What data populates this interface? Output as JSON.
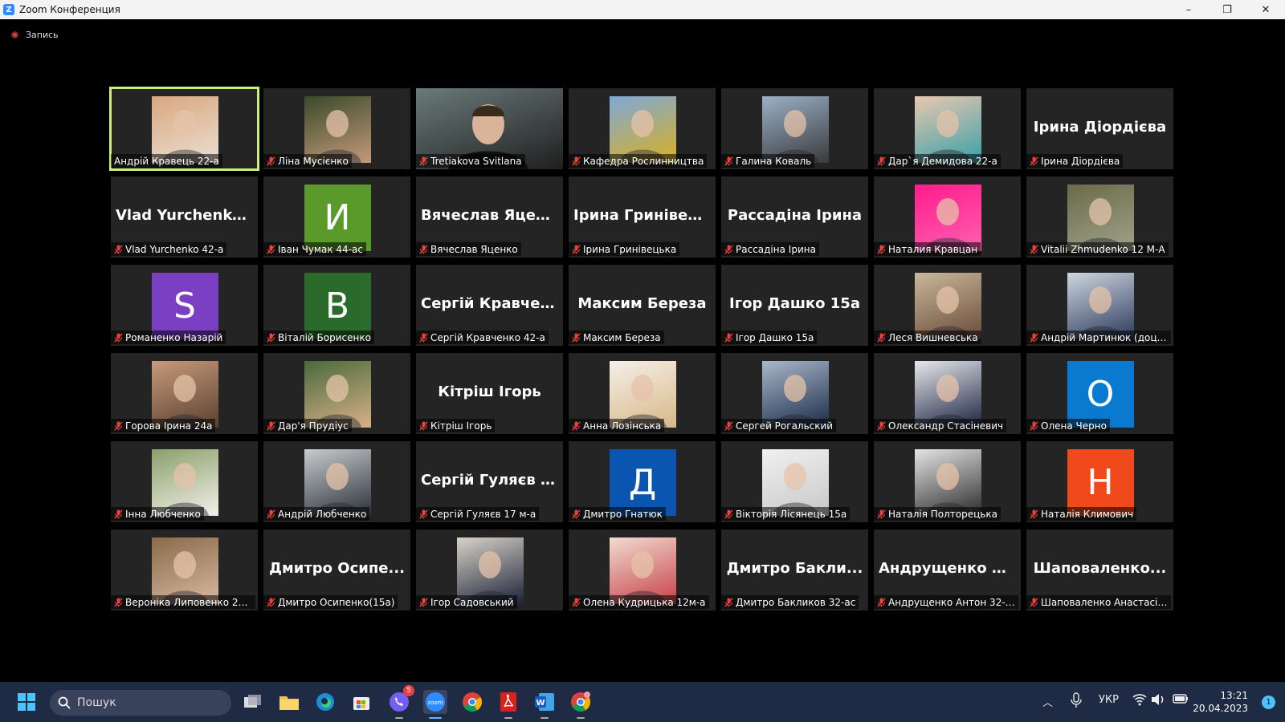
{
  "window": {
    "title": "Zoom Конференция",
    "minimize_glyph": "–",
    "restore_glyph": "❐",
    "close_glyph": "✕"
  },
  "recording": {
    "label": "Запись"
  },
  "participants": [
    {
      "label": "Андрій Кравець 22-а",
      "muted": false,
      "type": "photo",
      "active": true,
      "c1": "#d9a77f",
      "c2": "#eadfd2"
    },
    {
      "label": "Ліна Мусієнко",
      "muted": true,
      "type": "photo",
      "c1": "#3a4a2a",
      "c2": "#c49a7a"
    },
    {
      "label": "Tretiakova Svitlana",
      "muted": true,
      "type": "video",
      "c1": "#6b7a7a",
      "c2": "#1f1f1f"
    },
    {
      "label": "Кафедра Рослинництва",
      "muted": true,
      "type": "photo",
      "c1": "#7fa8d8",
      "c2": "#d9b021"
    },
    {
      "label": "Галина  Коваль",
      "muted": true,
      "type": "photo",
      "c1": "#9bb0c8",
      "c2": "#3a3a3a"
    },
    {
      "label": "Дар`я  Демидова 22-а",
      "muted": true,
      "type": "photo",
      "c1": "#e7c8b0",
      "c2": "#3aa0a8"
    },
    {
      "label": "Ірина Діордієва",
      "muted": true,
      "type": "name",
      "big": "Ірина Діордієва"
    },
    {
      "label": "Vlad Yurchenko 42-а",
      "muted": true,
      "type": "name",
      "big": "Vlad Yurchenko..."
    },
    {
      "label": "Іван Чумак 44-ас",
      "muted": true,
      "type": "avatar",
      "letter": "И",
      "color": "#5a9a2a"
    },
    {
      "label": "Вячеслав Яценко",
      "muted": true,
      "type": "name",
      "big": "Вячеслав Яценко"
    },
    {
      "label": "Ірина Гринівецька",
      "muted": true,
      "type": "name",
      "big": "Ірина Гринівец..."
    },
    {
      "label": "Рассадіна Ірина",
      "muted": true,
      "type": "name",
      "big": "Рассадіна Ірина"
    },
    {
      "label": "Наталия Кравцан",
      "muted": true,
      "type": "photo",
      "c1": "#ff1c8c",
      "c2": "#ff60b0"
    },
    {
      "label": "Vitalii Zhmudenko 12 М-А",
      "muted": true,
      "type": "photo",
      "c1": "#6b6a4a",
      "c2": "#a0a28a"
    },
    {
      "label": "Романенко Назарій",
      "muted": true,
      "type": "avatar",
      "letter": "S",
      "color": "#7a3fc2"
    },
    {
      "label": "Віталій Борисенко",
      "muted": true,
      "type": "avatar",
      "letter": "B",
      "color": "#2a6a2a"
    },
    {
      "label": "Сергій Кравченко 42-а",
      "muted": true,
      "type": "name",
      "big": "Сергій Кравчен..."
    },
    {
      "label": "Максим Береза",
      "muted": true,
      "type": "name",
      "big": "Максим Береза"
    },
    {
      "label": "Ігор Дашко 15а",
      "muted": true,
      "type": "name",
      "big": "Ігор Дашко 15а"
    },
    {
      "label": "Леся Вишневська",
      "muted": true,
      "type": "photo",
      "c1": "#c8b89a",
      "c2": "#6a4a3a"
    },
    {
      "label": "Андрій Мартинюк (доце...",
      "muted": true,
      "type": "photo",
      "c1": "#cfd6e0",
      "c2": "#2a3a5a"
    },
    {
      "label": "Горова Ірина 24а",
      "muted": true,
      "type": "photo",
      "c1": "#c89a7a",
      "c2": "#5a4030"
    },
    {
      "label": "Дар'я Прудіус",
      "muted": true,
      "type": "photo",
      "c1": "#4a6a3a",
      "c2": "#d8b08a"
    },
    {
      "label": "Кітріш Ігорь",
      "muted": true,
      "type": "name",
      "big": "Кітріш Ігорь"
    },
    {
      "label": "Анна Лозінська",
      "muted": true,
      "type": "photo",
      "c1": "#f4efe8",
      "c2": "#d8b888"
    },
    {
      "label": "Сергей Рогальский",
      "muted": true,
      "type": "photo",
      "c1": "#aab8c8",
      "c2": "#1a2a4a"
    },
    {
      "label": "Олександр Стасіневич",
      "muted": true,
      "type": "photo",
      "c1": "#e6e8ec",
      "c2": "#1a2240"
    },
    {
      "label": "Олена Черно",
      "muted": true,
      "type": "avatar",
      "letter": "О",
      "color": "#0a7ad0"
    },
    {
      "label": "Інна Любченко",
      "muted": true,
      "type": "photo",
      "c1": "#8aa06a",
      "c2": "#f2f0ea"
    },
    {
      "label": "Андрій Любченко",
      "muted": true,
      "type": "photo",
      "c1": "#c8ccd0",
      "c2": "#2a3038"
    },
    {
      "label": "Сергій Гуляєв 17 м-а",
      "muted": true,
      "type": "name",
      "big": "Сергій Гуляєв 1..."
    },
    {
      "label": "Дмитро Гнатюк",
      "muted": true,
      "type": "avatar",
      "letter": "Д",
      "color": "#0a55b0"
    },
    {
      "label": "Вікторія Лісянець 15а",
      "muted": true,
      "type": "photo",
      "c1": "#f0f0f0",
      "c2": "#c8c8c8"
    },
    {
      "label": "Наталія Полторецька",
      "muted": true,
      "type": "photo",
      "c1": "#e4e4e4",
      "c2": "#2a2a2a"
    },
    {
      "label": "Наталія Климович",
      "muted": true,
      "type": "avatar",
      "letter": "Н",
      "color": "#f04a1c"
    },
    {
      "label": "Вероніка Липовенко 24-...",
      "muted": true,
      "type": "photo",
      "c1": "#8a6a4a",
      "c2": "#d8b8a0"
    },
    {
      "label": "Дмитро Осипенко(15а)",
      "muted": true,
      "type": "name",
      "big": "Дмитро Осипе..."
    },
    {
      "label": "Ігор Садовський",
      "muted": true,
      "type": "photo",
      "c1": "#d8d2c8",
      "c2": "#1c2238"
    },
    {
      "label": "Олена Кудрицька 12м-а",
      "muted": true,
      "type": "photo",
      "c1": "#f0dcd0",
      "c2": "#c84048"
    },
    {
      "label": "Дмитро Бакликов 32-ас",
      "muted": true,
      "type": "name",
      "big": "Дмитро Бакли..."
    },
    {
      "label": "Андрущенко Антон 32-ас",
      "muted": true,
      "type": "name",
      "big": "Андрущенко А..."
    },
    {
      "label": "Шаповаленко Анастасія, ...",
      "muted": true,
      "type": "name",
      "big": "Шаповаленко..."
    }
  ],
  "taskbar": {
    "search_label": "Пошук",
    "viber_badge": "5",
    "language": "УКР",
    "time": "13:21",
    "date": "20.04.2023",
    "notifications": "1",
    "zoom_icon_text": "zoom",
    "chevron_glyph": "︿"
  }
}
